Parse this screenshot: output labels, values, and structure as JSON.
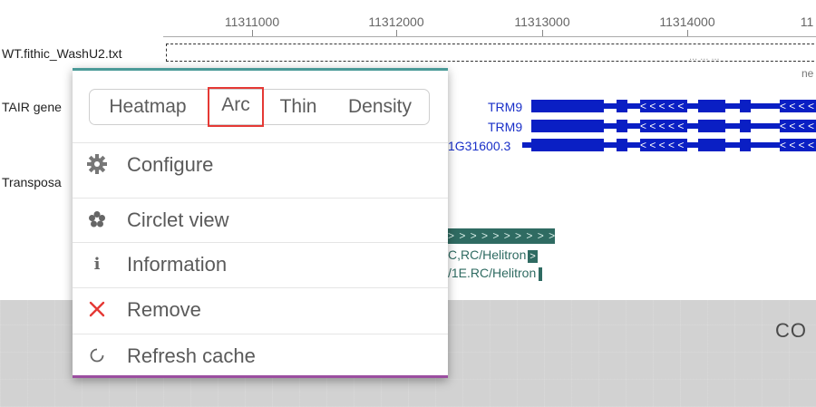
{
  "ruler": {
    "labels": [
      "11311000",
      "11312000",
      "11313000",
      "11314000",
      "11"
    ]
  },
  "tracks": {
    "fithic": {
      "label": "WT.fithic_WashU2.txt",
      "faint_text": "... ... ...",
      "faint_right": "ne"
    },
    "tair": {
      "label": "TAIR gene"
    },
    "transposon": {
      "label": "Transposa"
    }
  },
  "genes": [
    {
      "name": "TRM9"
    },
    {
      "name": "TRM9"
    },
    {
      "name": "1G31600.3"
    }
  ],
  "gene_arrows": "<  < < <  < < <  <  < < <",
  "transposons": {
    "bar_text": "> > > > > > > > > >",
    "label1": "C,RC/Helitron",
    "label2": "/1E.RC/Helitron",
    "marker": ">"
  },
  "bottom_right_text": "CO",
  "menu": {
    "modes": [
      {
        "label": "Heatmap",
        "active": false
      },
      {
        "label": "Arc",
        "active": true
      },
      {
        "label": "Thin",
        "active": false
      },
      {
        "label": "Density",
        "active": false
      }
    ],
    "items": [
      {
        "label": "Configure",
        "icon": "gear-icon"
      },
      {
        "label": "Circlet view",
        "icon": "flower-icon"
      },
      {
        "label": "Information",
        "icon": "info-icon"
      },
      {
        "label": "Remove",
        "icon": "close-icon"
      },
      {
        "label": "Refresh cache",
        "icon": "refresh-icon"
      }
    ]
  },
  "colors": {
    "gene": "#0a1fc4",
    "transposon": "#2f6b62",
    "menu_top_border": "#4a9a98",
    "menu_bottom_border": "#9b4ea0",
    "active_outline": "#e53935",
    "remove_icon": "#e53935"
  }
}
